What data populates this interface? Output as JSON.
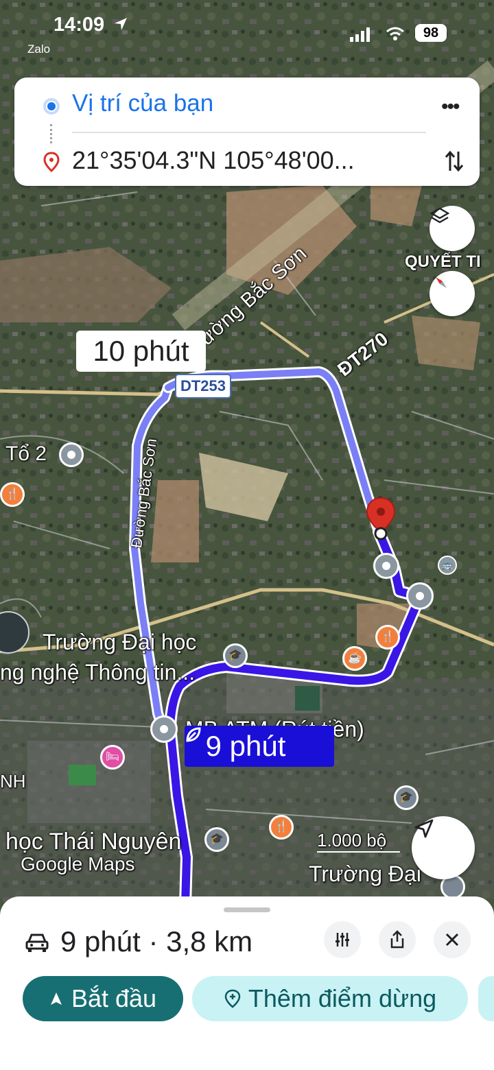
{
  "status_bar": {
    "time": "14:09",
    "notification_app": "Zalo",
    "battery": "98"
  },
  "route_inputs": {
    "origin": "Vị trí của bạn",
    "destination": "21°35'04.3\"N 105°48'00..."
  },
  "map": {
    "labels": {
      "duong_bac_son_top": "Đường Bắc Sơn",
      "dt270": "ĐT270",
      "duong_bac_son_left": "Đường Bắc Sơn",
      "to2": "Tổ 2",
      "quyet_thang": "QUYẾT TI",
      "truong_dh": "Trường Đại học",
      "cong_nghe": "ng nghệ Thông tin...",
      "mb_atm": "MB ATM (Rút tiền)",
      "nh": "NH",
      "hoc_thai_nguyen": "học Thái Nguyên",
      "truong_dai_bottom": "Trường Đại",
      "scale": "1.000 bộ",
      "watermark": "Google Maps"
    },
    "road_shield": "DT253",
    "alt_route_time": "10 phút",
    "main_route_time": "9 phút",
    "route_color": "#3a16e6",
    "alt_route_color": "#7b7ff5"
  },
  "bottom_sheet": {
    "summary": "9 phút · 3,8 km",
    "start_button": "Bắt đầu",
    "add_stop_button": "Thêm điểm dừng"
  },
  "colors": {
    "accent": "#176f73",
    "chip": "#c9f2f4",
    "link_blue": "#1a73e8",
    "pin_red": "#d93025"
  }
}
